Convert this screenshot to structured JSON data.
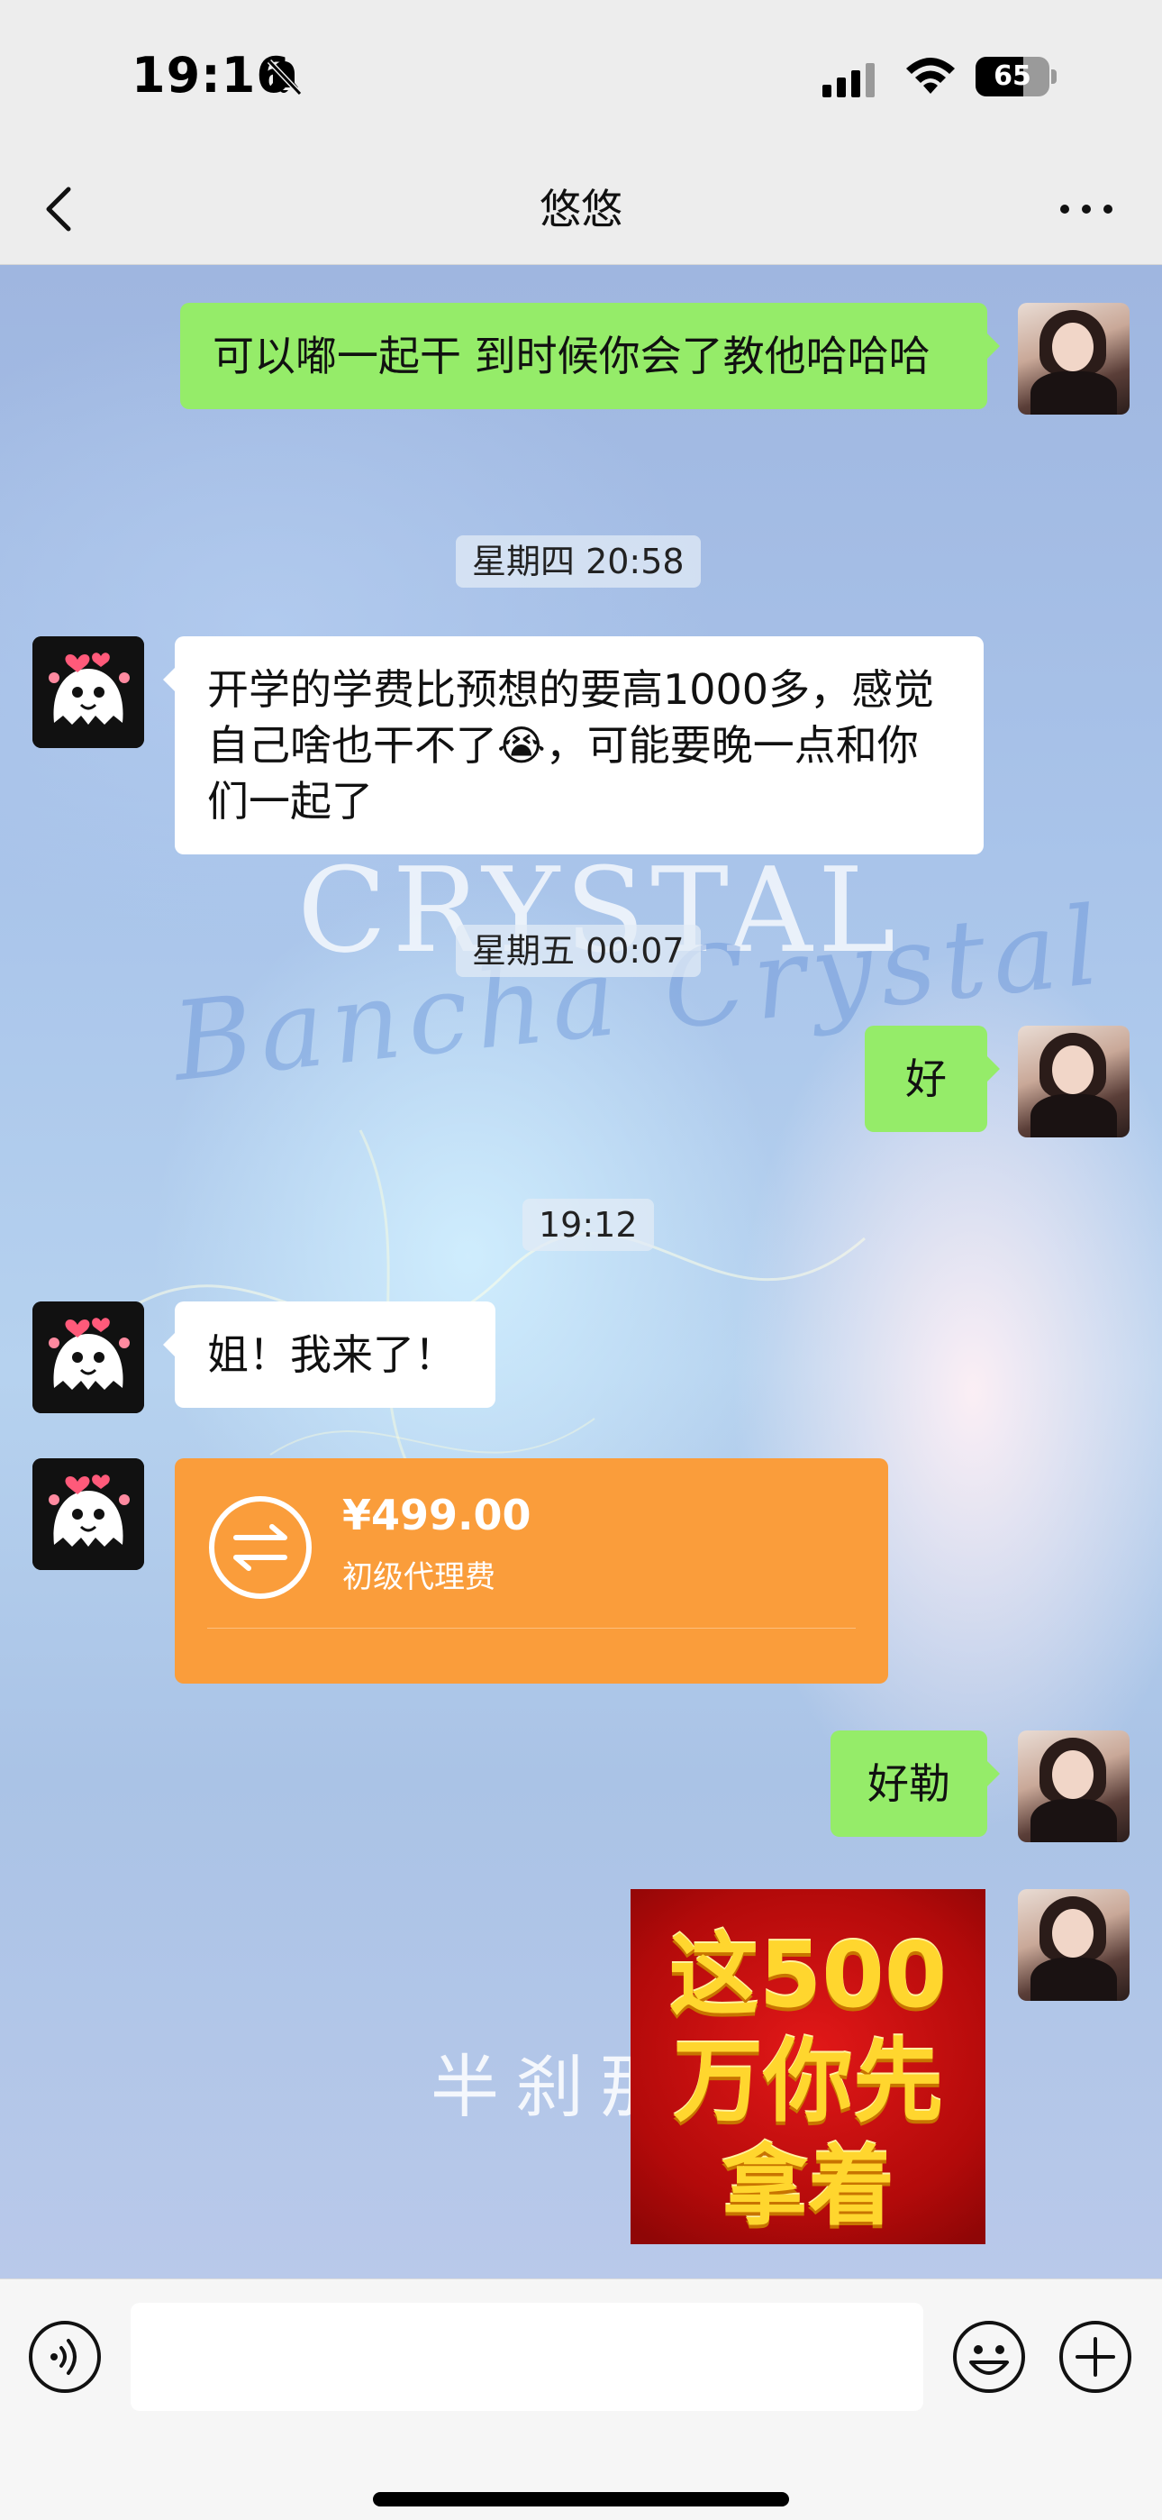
{
  "status_bar": {
    "time": "19:16",
    "battery": "65",
    "battery_level": 0.65
  },
  "nav": {
    "title": "悠悠"
  },
  "messages": [
    {
      "sender": "self",
      "text": "可以嘟一起干 到时候你会了教他哈哈哈"
    },
    {
      "time": "星期四 20:58"
    },
    {
      "sender": "peer",
      "text": "开学的学费比预想的要高1000多，感觉自己啥也干不了😭，可能要晚一点和你们一起了"
    },
    {
      "time": "星期五 00:07"
    },
    {
      "sender": "self",
      "text": "好"
    },
    {
      "time": "19:12"
    },
    {
      "sender": "peer",
      "text": "姐！我来了！"
    },
    {
      "sender": "peer",
      "transfer": {
        "amount": "¥499.00",
        "note": "初级代理费"
      }
    },
    {
      "sender": "self",
      "text": "好勒"
    },
    {
      "sender": "self",
      "sticker": {
        "lines": [
          "这500",
          "万你先",
          "拿着"
        ]
      }
    }
  ],
  "background": {
    "watermark_title": "CRYSTAL",
    "watermark_script": "Bancha Crystal",
    "watermark_bottom": "半刹那"
  },
  "colors": {
    "self_bubble": "#95ec69",
    "peer_bubble": "#ffffff",
    "transfer": "#fa9d3b"
  }
}
